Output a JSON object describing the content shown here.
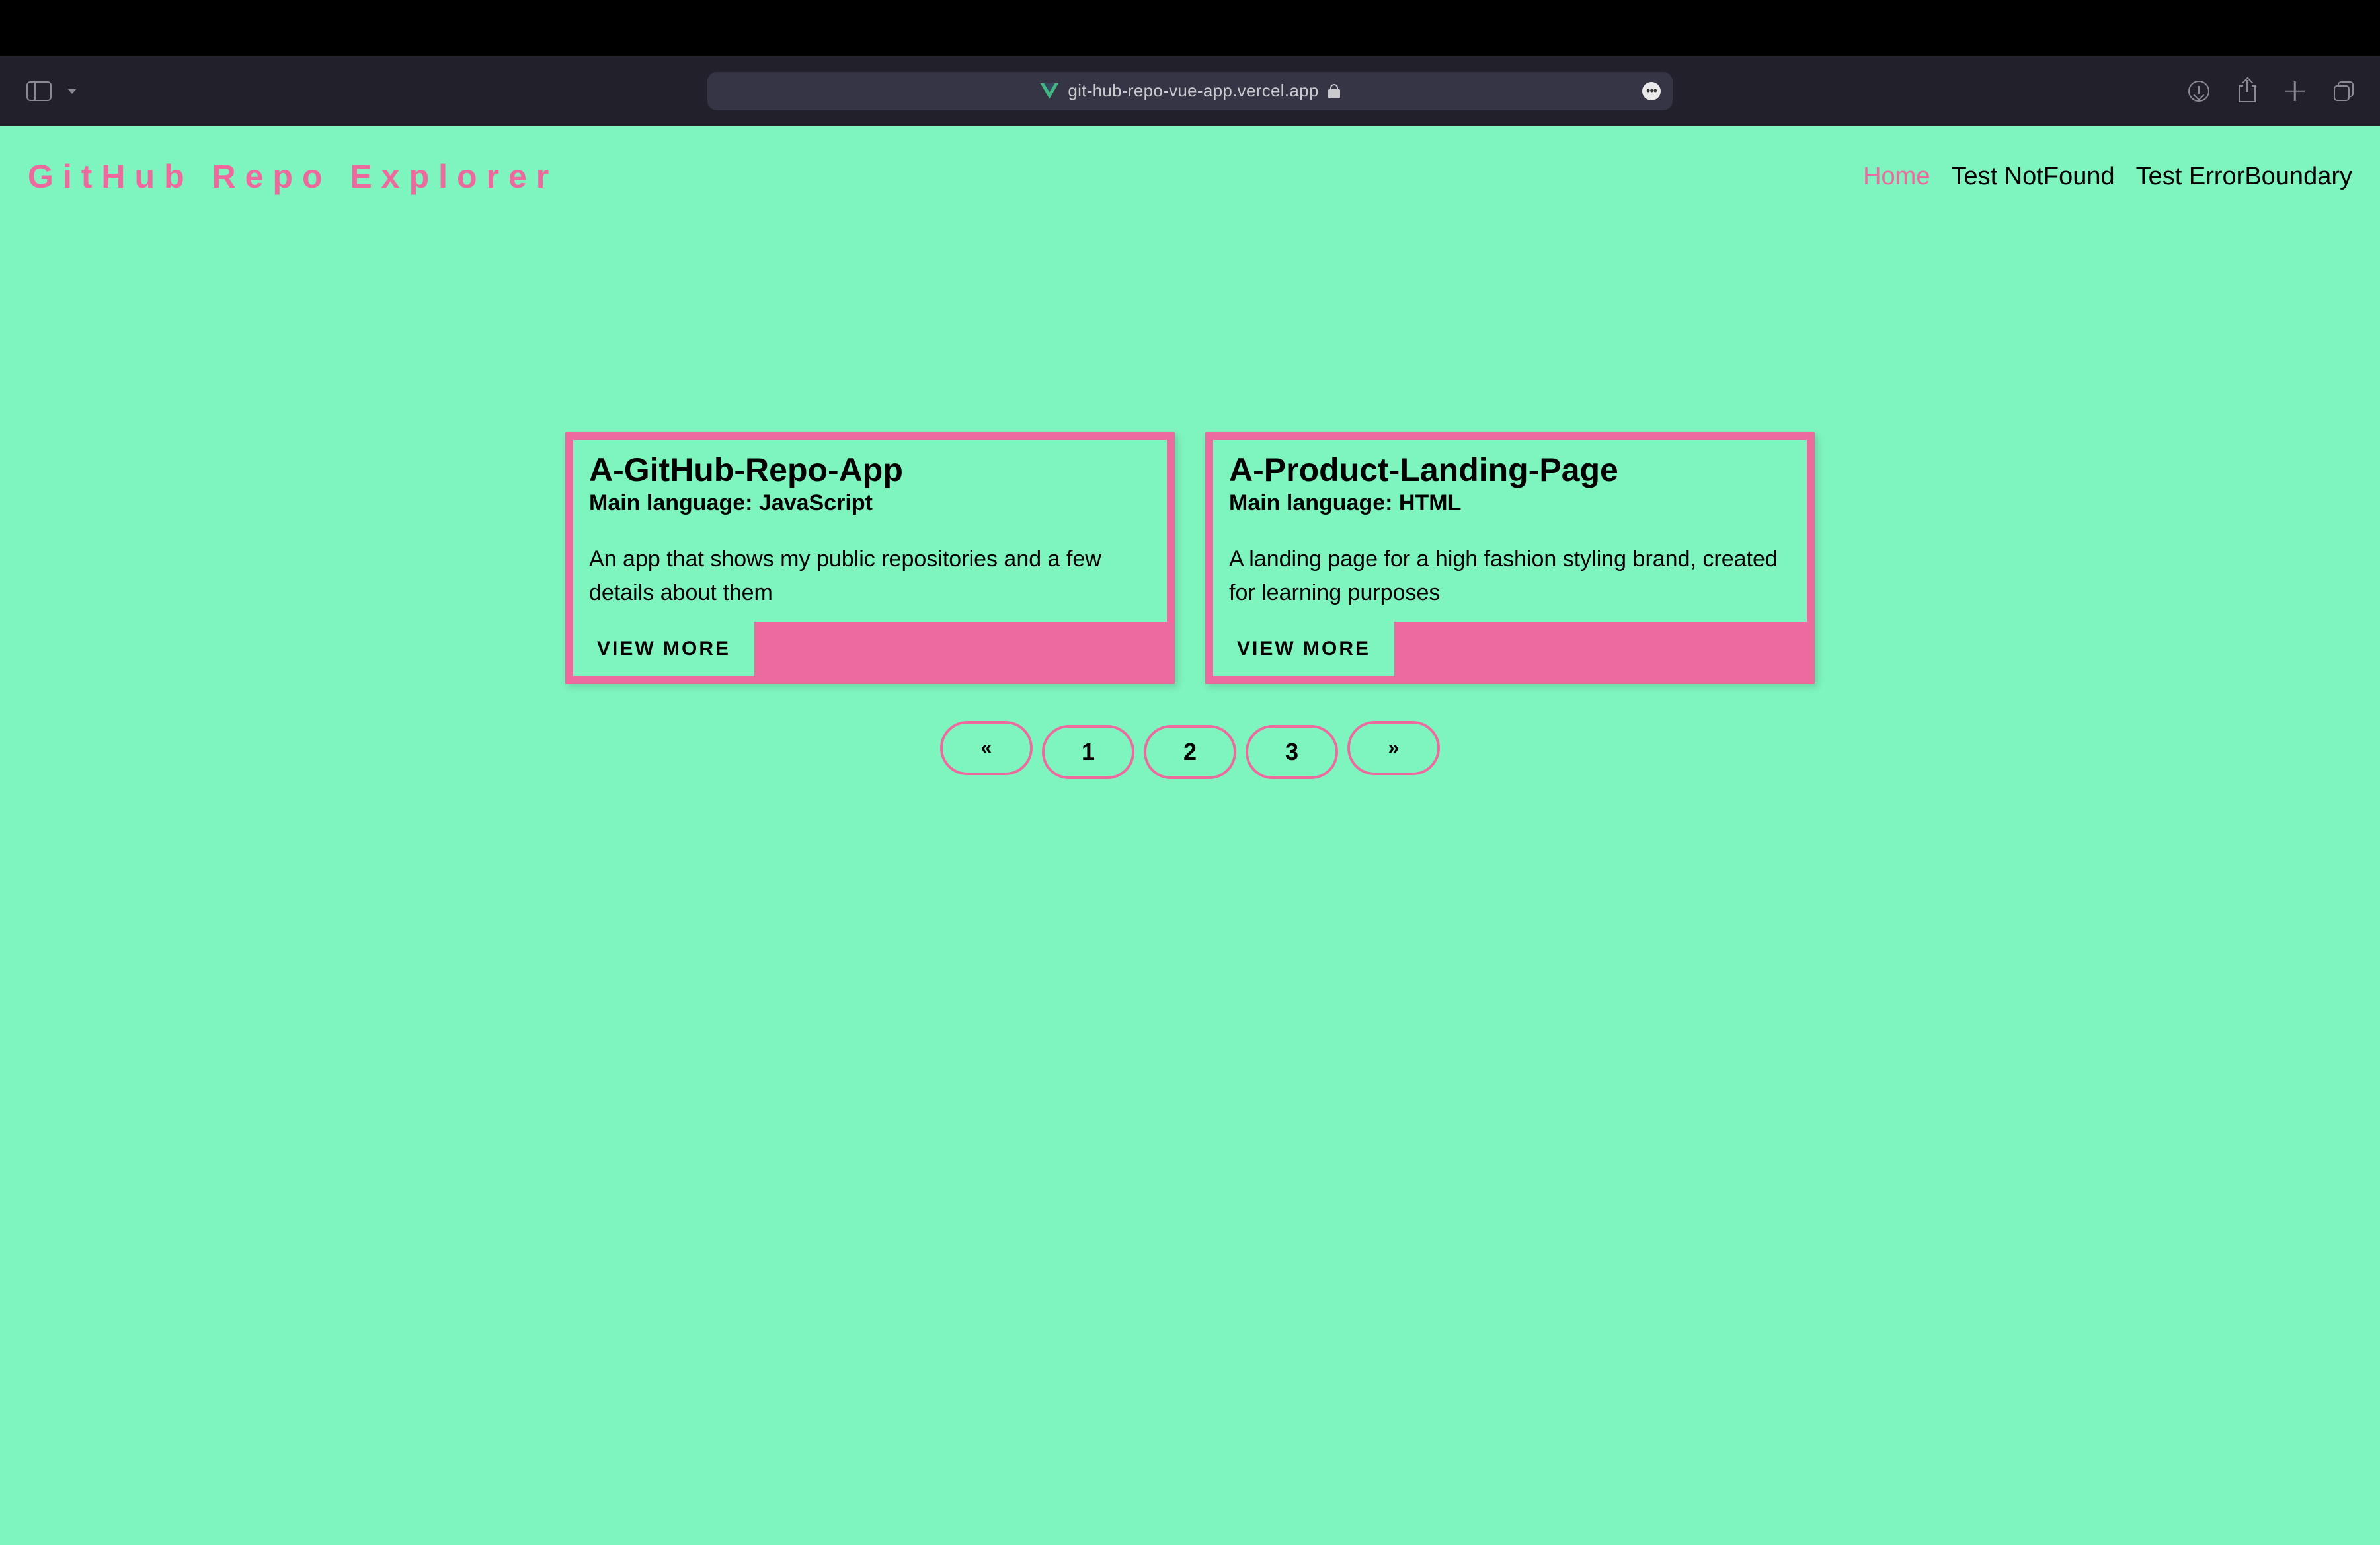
{
  "browser": {
    "url": "git-hub-repo-vue-app.vercel.app"
  },
  "header": {
    "logo": "GitHub Repo Explorer",
    "nav": [
      {
        "label": "Home",
        "active": true
      },
      {
        "label": "Test NotFound",
        "active": false
      },
      {
        "label": "Test ErrorBoundary",
        "active": false
      }
    ]
  },
  "cards": [
    {
      "title": "A-GitHub-Repo-App",
      "language_prefix": "Main language: ",
      "language": "JavaScript",
      "description": "An app that shows my public repositories and a few details about them",
      "button": "VIEW MORE"
    },
    {
      "title": "A-Product-Landing-Page",
      "language_prefix": "Main language: ",
      "language": "HTML",
      "description": "A landing page for a high fashion styling brand, created for learning purposes",
      "button": "VIEW MORE"
    }
  ],
  "pagination": {
    "prev": "«",
    "pages": [
      "1",
      "2",
      "3"
    ],
    "next": "»"
  }
}
